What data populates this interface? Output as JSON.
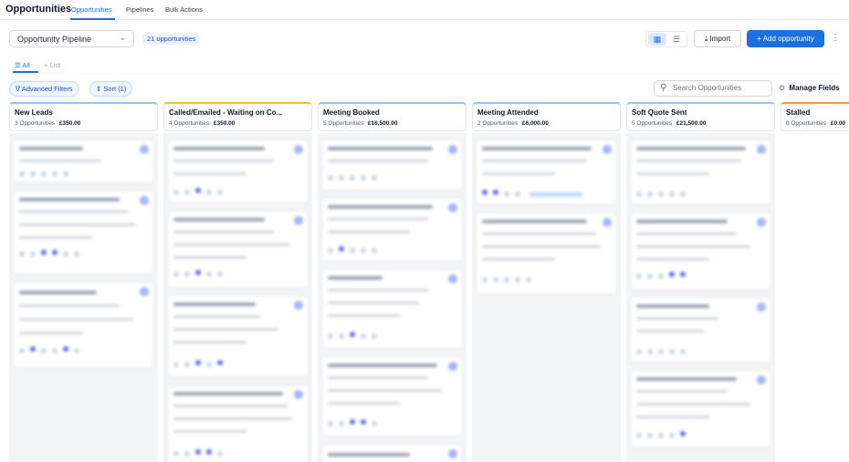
{
  "app_title": "Opportunities",
  "nav_tabs": [
    "Opportunities",
    "Pipelines",
    "Bulk Actions"
  ],
  "pipeline_select": {
    "label": "Opportunity Pipeline"
  },
  "count_badge": "21 opportunities",
  "toolbar": {
    "import_label": "Import",
    "add_label": "Add opportunity"
  },
  "view_tabs": {
    "all": "All",
    "list": "List"
  },
  "filters": {
    "advanced": "Advanced Filters",
    "sort": "Sort (1)"
  },
  "search": {
    "placeholder": "Search Opportunities"
  },
  "manage_fields": "Manage Fields",
  "columns": [
    {
      "title": "New Leads",
      "count": "3 Opportunities",
      "value": "£350.00"
    },
    {
      "title": "Called/Emailed - Waiting on Co...",
      "count": "4 Opportunities",
      "value": "£350.00"
    },
    {
      "title": "Meeting Booked",
      "count": "5 Opportunities",
      "value": "£16,500.00"
    },
    {
      "title": "Meeting Attended",
      "count": "2 Opportunities",
      "value": "£6,000.00"
    },
    {
      "title": "Soft Quote Sent",
      "count": "5 Opportunities",
      "value": "£21,500.00"
    },
    {
      "title": "Stalled",
      "count": "0 Opportunities",
      "value": "£0.00"
    }
  ],
  "colors": {
    "accent": "#1d6fe0",
    "badge_bg": "#eef2ff",
    "column_bg": "#f3f4f6"
  }
}
